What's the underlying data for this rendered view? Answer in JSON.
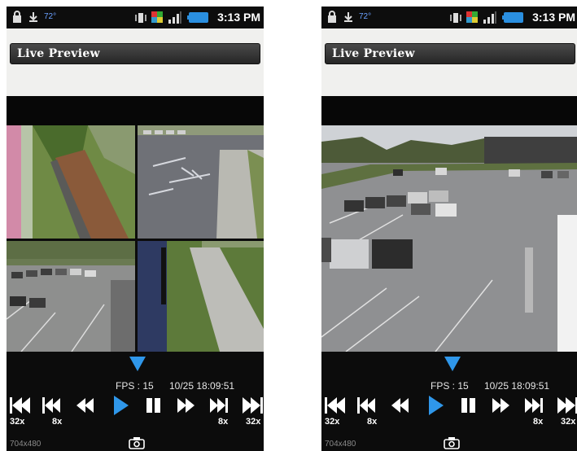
{
  "status": {
    "temperature": "72°",
    "time": "3:13 PM"
  },
  "app": {
    "title": "Live Preview"
  },
  "playback": {
    "fps": "FPS : 15",
    "timestamp": "10/25 18:09:51",
    "speeds": [
      "32x",
      "8x",
      "",
      "",
      "",
      "",
      "8x",
      "32x"
    ],
    "resolution": "704x480"
  },
  "colors": {
    "accent": "#2f97ea",
    "titlebar": "#2f2f2f",
    "statusbar": "#0d0d0d"
  },
  "icons": [
    "lock-icon",
    "download-icon",
    "vibrate-icon",
    "app-notification-icon",
    "signal-icon",
    "battery-icon",
    "toggle-triangle-icon",
    "rewind-32x-icon",
    "rewind-8x-icon",
    "rewind-icon",
    "play-icon",
    "pause-icon",
    "fast-forward-icon",
    "fast-forward-8x-icon",
    "fast-forward-32x-icon",
    "camera-snapshot-icon"
  ],
  "views": {
    "left": "quad camera grid",
    "right": "single camera"
  }
}
